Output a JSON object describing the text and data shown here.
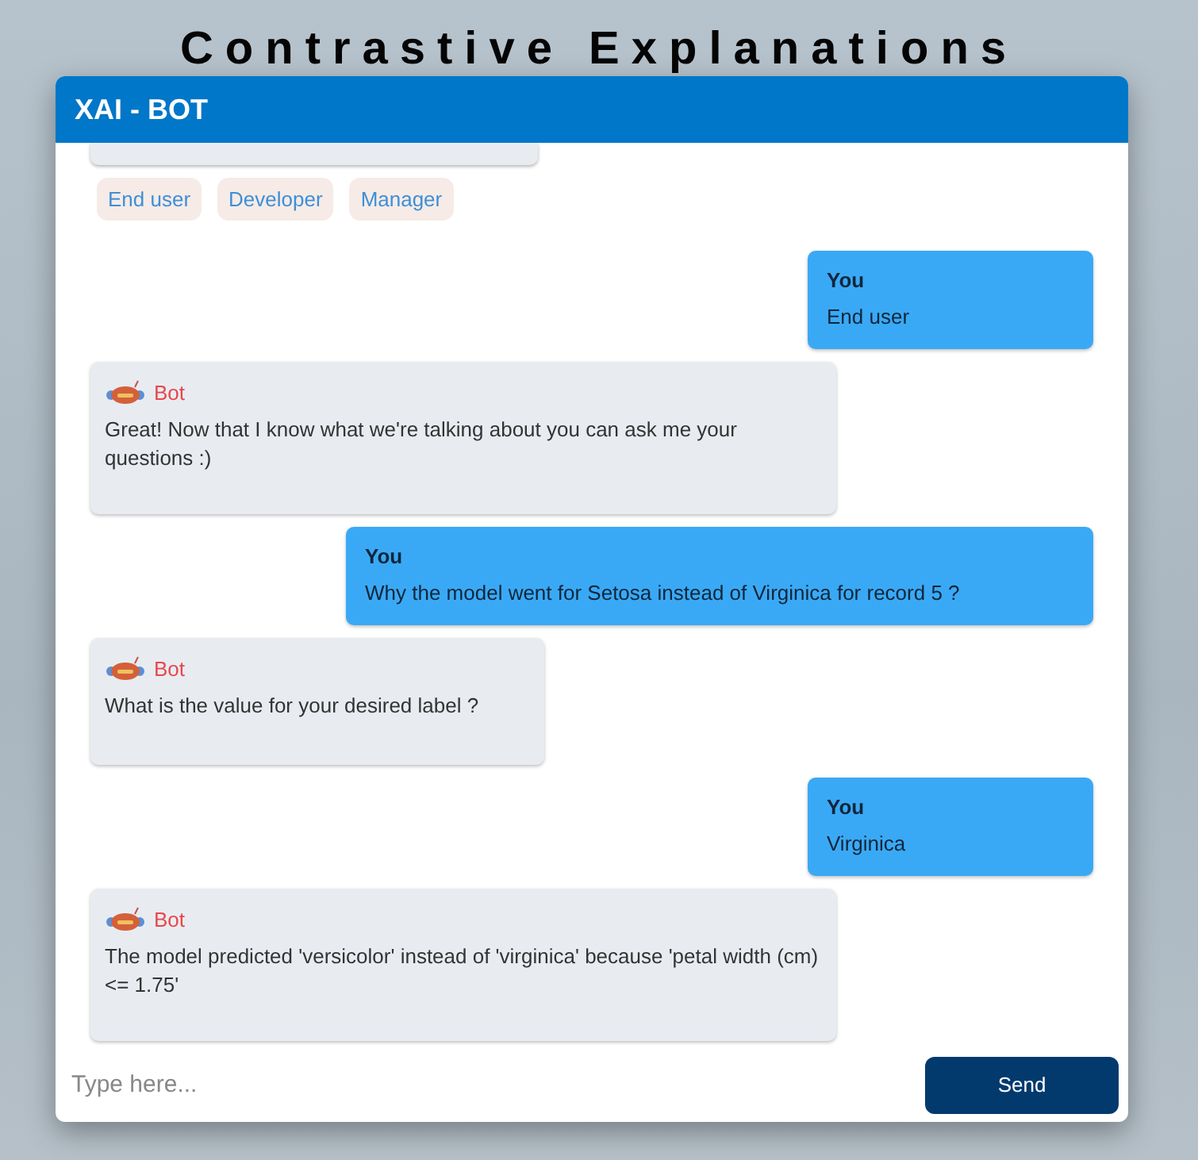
{
  "page_title": "Contrastive Explanations",
  "window": {
    "title": "XAI - BOT"
  },
  "options": [
    "End user",
    "Developer",
    "Manager"
  ],
  "messages": [
    {
      "kind": "user",
      "sender": "You",
      "text": "End user"
    },
    {
      "kind": "bot",
      "sender": "Bot",
      "text": "Great! Now that I know what we're talking about you can ask me your questions :)"
    },
    {
      "kind": "user",
      "sender": "You",
      "text": "Why the model went for Setosa instead of Virginica for record 5 ?"
    },
    {
      "kind": "bot",
      "sender": "Bot",
      "text": "What is the value for your desired label ?"
    },
    {
      "kind": "user",
      "sender": "You",
      "text": "Virginica"
    },
    {
      "kind": "bot",
      "sender": "Bot",
      "text": "The model predicted 'versicolor' instead of 'virginica' because 'petal width (cm) <= 1.75'"
    }
  ],
  "composer": {
    "placeholder": "Type here...",
    "send": "Send"
  }
}
